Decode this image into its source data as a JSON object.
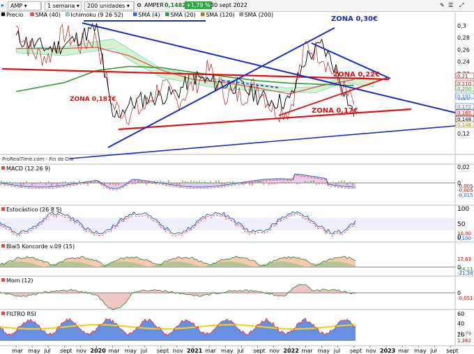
{
  "toolbar": {
    "symbol": "AMP",
    "period": "1 semana",
    "units": "200 unidades",
    "ticker": "AMPER",
    "price": "0,1482",
    "change": "+1,79 %",
    "date": "30 sept 2022"
  },
  "legend": [
    {
      "label": "Precio",
      "color": "#000000"
    },
    {
      "label": "SMA (40)",
      "color": "#e05050"
    },
    {
      "label": "Ichimoku (9 26 52)",
      "color": "#8fd7c4"
    },
    {
      "label": "SMA (4)",
      "color": "#2a6fd6"
    },
    {
      "label": "SMA (20)",
      "color": "#2f9c2f"
    },
    {
      "label": "SMA (120)",
      "color": "#b08020"
    },
    {
      "label": "SMA (200)",
      "color": "#9a9a9a"
    }
  ],
  "source_note": "ProRealTime.com - Fin de Día",
  "annotations": {
    "zona030": "ZONA 0,30€",
    "zona022": "ZONA 0,22€",
    "zona0187": "ZONA 0,187€",
    "zona017": "ZONA 0,17€"
  },
  "x_labels": [
    "mar",
    "may",
    "jul",
    "sept",
    "nov",
    "2020",
    "mar",
    "may",
    "jul",
    "sept",
    "nov",
    "2021",
    "mar",
    "may",
    "jul",
    "sept",
    "nov",
    "2022",
    "mar",
    "may",
    "jul",
    "sept",
    "nov",
    "2023",
    "mar",
    "may",
    "jul",
    "sept"
  ],
  "main_axis": [
    "0,3",
    "0,28",
    "0,26",
    "0,24",
    "0,22",
    "0,2",
    "0,18",
    "0,16",
    "0,14",
    "0,12"
  ],
  "main_right_badges": [
    {
      "text": "0,21",
      "color": "#cc0000"
    },
    {
      "text": "0,210",
      "color": "#cc0000"
    },
    {
      "text": "0,200",
      "color": "#2f9c2f"
    },
    {
      "text": "0,191",
      "color": "#2a6fd6"
    },
    {
      "text": "0,172",
      "color": "#2a6fd6"
    },
    {
      "text": "0,165",
      "color": "#cc0000"
    },
    {
      "text": "0,148",
      "color": "#000000"
    },
    {
      "text": "0,148",
      "color": "#b08020"
    }
  ],
  "panels": [
    {
      "title": "MACD (12 26 9)",
      "axis": [
        "0,02",
        "0"
      ],
      "badges": [
        "-0,005",
        "-0,005",
        "-0,015"
      ]
    },
    {
      "title": "Estocástico (26 8 5)",
      "axis": [
        "100",
        "50",
        "0"
      ],
      "badges": [
        "10,00",
        "6,100"
      ]
    },
    {
      "title": "Blai5 Koncorde v.09 (15)",
      "axis": [
        "0"
      ],
      "badges": [
        "17,63",
        "-34,11",
        "-31,38"
      ]
    },
    {
      "title": "Mom (12)",
      "axis": [
        "0"
      ],
      "badges": [
        "-0,051"
      ]
    },
    {
      "title": "FILTRO RSI",
      "axis": [
        "60",
        "40",
        "20"
      ],
      "badges": [
        "31,79",
        "1,362"
      ]
    }
  ],
  "chart_data": {
    "type": "line",
    "title": "AMPER · 1 semana",
    "xlabel": "",
    "ylabel": "",
    "ylim": [
      0.1,
      0.31
    ],
    "grid": false,
    "legend_position": "top-left",
    "series": [
      {
        "name": "Precio",
        "x": [
          "2019-03",
          "2019-05",
          "2019-07",
          "2019-09",
          "2019-11",
          "2020-01",
          "2020-03",
          "2020-05",
          "2020-07",
          "2020-09",
          "2020-11",
          "2021-01",
          "2021-03",
          "2021-05",
          "2021-07",
          "2021-09",
          "2021-11",
          "2022-01",
          "2022-03",
          "2022-05",
          "2022-07",
          "2022-09"
        ],
        "values": [
          0.28,
          0.27,
          0.262,
          0.268,
          0.282,
          0.296,
          0.145,
          0.168,
          0.178,
          0.182,
          0.188,
          0.215,
          0.206,
          0.202,
          0.198,
          0.182,
          0.174,
          0.174,
          0.245,
          0.268,
          0.222,
          0.148
        ]
      },
      {
        "name": "SMA (40)",
        "x": [
          "2019-03",
          "2019-09",
          "2020-01",
          "2020-05",
          "2020-09",
          "2021-01",
          "2021-05",
          "2021-09",
          "2022-01",
          "2022-05",
          "2022-09"
        ],
        "values": [
          0.262,
          0.262,
          0.264,
          0.25,
          0.226,
          0.21,
          0.205,
          0.196,
          0.186,
          0.2,
          0.21
        ]
      },
      {
        "name": "SMA (20)",
        "x": [
          "2019-03",
          "2019-09",
          "2020-01",
          "2020-05",
          "2020-09",
          "2021-01",
          "2021-05",
          "2021-09",
          "2022-01",
          "2022-05",
          "2022-09"
        ],
        "values": [
          0.19,
          0.205,
          0.225,
          0.232,
          0.23,
          0.222,
          0.215,
          0.208,
          0.204,
          0.202,
          0.2
        ]
      }
    ]
  }
}
